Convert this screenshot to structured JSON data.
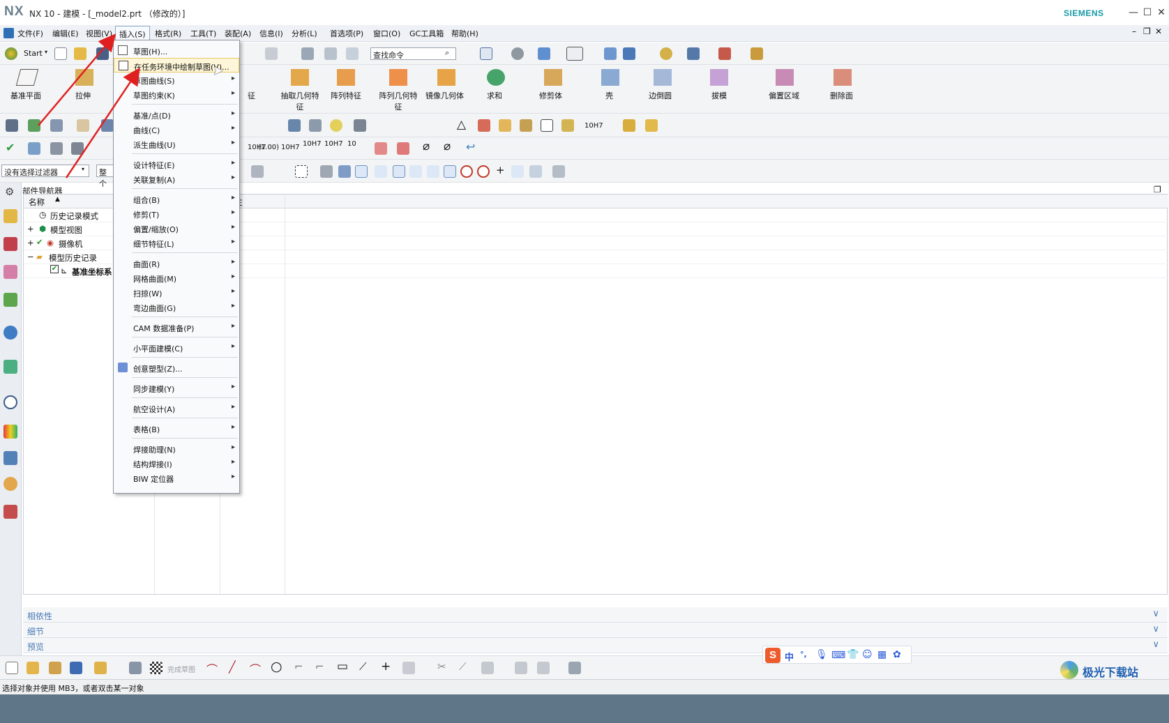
{
  "window": {
    "app_logo": "NX",
    "title": "NX 10 - 建模 - [_model2.prt （修改的）]",
    "brand": "SIEMENS",
    "controls": [
      "minimize-icon",
      "maximize-icon",
      "close-icon"
    ]
  },
  "menubar": {
    "items": [
      "文件(F)",
      "编辑(E)",
      "视图(V)",
      "插入(S)",
      "格式(R)",
      "工具(T)",
      "装配(A)",
      "信息(I)",
      "分析(L)",
      "首选项(P)",
      "窗口(O)",
      "GC工具箱",
      "帮助(H)"
    ],
    "active": "插入(S)"
  },
  "standard_toolbar": {
    "start_label": "Start",
    "search_placeholder": "查找命令"
  },
  "feature_toolbar": {
    "labels": [
      "基准平面",
      "拉伸",
      "征",
      "抽取几何特征",
      "阵列特征",
      "阵列几何特征",
      "镜像几何体",
      "求和",
      "修剪体",
      "壳",
      "边倒圆",
      "拔模",
      "偏置区域",
      "删除面"
    ]
  },
  "pmi_toolbar": {
    "labels": [
      "10H7",
      "(1.00)",
      "10H7",
      "10H7",
      "10H7",
      "10",
      "10H7"
    ]
  },
  "filter_bar": {
    "selection_filter": "没有选择过滤器",
    "scope": "整个"
  },
  "navigator": {
    "title": "部件导航器",
    "column_name": "名称",
    "column_extra": "注",
    "rows": [
      {
        "label": "历史记录模式",
        "icon": "clock-icon"
      },
      {
        "label": "模型视图",
        "icon": "model-views-icon"
      },
      {
        "label": "摄像机",
        "icon": "camera-icon"
      },
      {
        "label": "模型历史记录",
        "icon": "folder-icon"
      },
      {
        "label": "基准坐标系",
        "icon": "datum-csys-icon"
      }
    ]
  },
  "panels": [
    "相依性",
    "细节",
    "预览"
  ],
  "insert_menu": {
    "items": [
      {
        "label": "草图(H)...",
        "submenu": false,
        "icon": "sketch-icon"
      },
      {
        "label": "在任务环境中绘制草图(V)...",
        "submenu": false,
        "icon": "task-sketch-icon",
        "highlighted": true
      },
      {
        "label": "草图曲线(S)",
        "submenu": true
      },
      {
        "label": "草图约束(K)",
        "submenu": true
      },
      {
        "label": "基准/点(D)",
        "submenu": true
      },
      {
        "label": "曲线(C)",
        "submenu": true
      },
      {
        "label": "派生曲线(U)",
        "submenu": true
      },
      {
        "label": "设计特征(E)",
        "submenu": true
      },
      {
        "label": "关联复制(A)",
        "submenu": true
      },
      {
        "label": "组合(B)",
        "submenu": true
      },
      {
        "label": "修剪(T)",
        "submenu": true
      },
      {
        "label": "偏置/缩放(O)",
        "submenu": true
      },
      {
        "label": "细节特征(L)",
        "submenu": true
      },
      {
        "label": "曲面(R)",
        "submenu": true
      },
      {
        "label": "网格曲面(M)",
        "submenu": true
      },
      {
        "label": "扫掠(W)",
        "submenu": true
      },
      {
        "label": "弯边曲面(G)",
        "submenu": true
      },
      {
        "label": "CAM 数据准备(P)",
        "submenu": true
      },
      {
        "label": "小平面建模(C)",
        "submenu": true
      },
      {
        "label": "创意塑型(Z)...",
        "submenu": false,
        "icon": "nx-realize-icon"
      },
      {
        "label": "同步建模(Y)",
        "submenu": true
      },
      {
        "label": "航空设计(A)",
        "submenu": true
      },
      {
        "label": "表格(B)",
        "submenu": true
      },
      {
        "label": "焊接助理(N)",
        "submenu": true
      },
      {
        "label": "结构焊接(I)",
        "submenu": true
      },
      {
        "label": "BIW 定位器",
        "submenu": true
      }
    ]
  },
  "sketch_toolbar": {
    "finish_label": "完成草图"
  },
  "ime_toolbar": {
    "logo": "S",
    "mode": "中",
    "punct": "°,"
  },
  "statusbar": {
    "message": "选择对象并使用 MB3，或者双击某一对象"
  },
  "watermark": "极光下载站",
  "colors": {
    "accent_blue": "#4a7ab5",
    "brand_teal": "#179aa6",
    "arrow_red": "#e02020",
    "menu_highlight": "#fdf6d8"
  }
}
